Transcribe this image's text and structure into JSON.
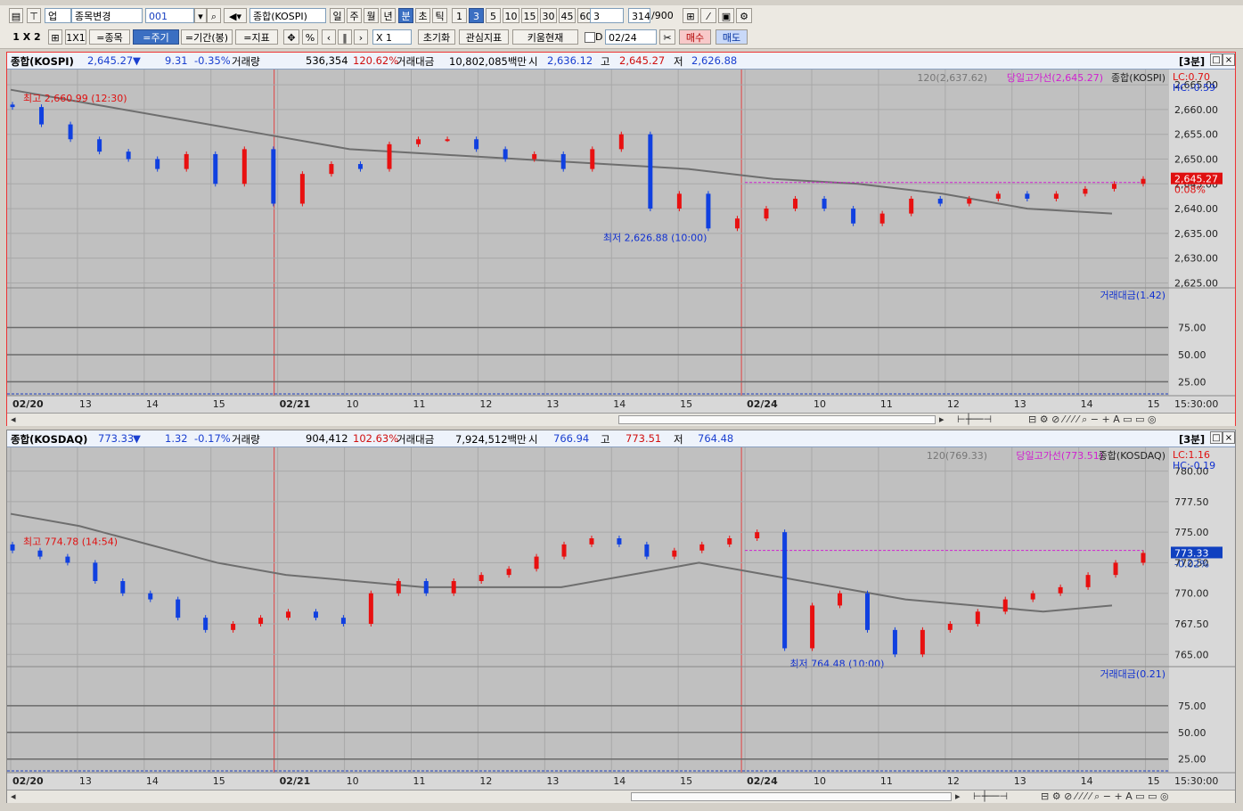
{
  "toolbar1": {
    "market": "업",
    "change_item": "종목변경",
    "code": "001",
    "name": "종합(KOSPI)",
    "periods": [
      "일",
      "주",
      "월",
      "년",
      "분",
      "초",
      "틱"
    ],
    "active_period": "분",
    "minutes": [
      "1",
      "3",
      "5",
      "10",
      "15",
      "30",
      "45",
      "60"
    ],
    "active_minute": "3",
    "count_select": "3",
    "count": "314",
    "count_max": "/900"
  },
  "toolbar2": {
    "layout": "1 X 2",
    "layout2": "1X1",
    "btn_item": "=종목",
    "btn_cycle": "=주기",
    "btn_period": "=기간(봉)",
    "btn_indicator": "=지표",
    "zoom": "X 1",
    "reset": "초기화",
    "watch": "관심지표",
    "kiwoom": "키움현재",
    "date_label": "D",
    "date": "02/24",
    "buy": "매수",
    "sell": "매도"
  },
  "panel_icons": {
    "restore": "□",
    "close": "×"
  },
  "charts": [
    {
      "header": {
        "name": "종합(KOSPI)",
        "price": "2,645.27",
        "arrow": "▼",
        "change": "9.31",
        "rate": "-0.35%",
        "vol_label": "거래량",
        "volume": "536,354",
        "vol_rate": "120.62%",
        "amt_label": "거래대금",
        "amount": "10,802,085백만",
        "open_label": "시",
        "open": "2,636.12",
        "high_label": "고",
        "high": "2,645.27",
        "low_label": "저",
        "low": "2,626.88",
        "interval": "[3분]"
      },
      "legend": {
        "ma": "120(2,637.62)",
        "limit": "당일고가선(2,645.27)",
        "main": "종합(KOSPI)"
      },
      "lc": "LC:0.70",
      "hc": "HC:-0.59",
      "current_label": "2,645.27",
      "current_pct": "0.08%",
      "max_note": "최고 2,660.99 (12:30)",
      "min_note": "최저 2,626.88 (10:00)",
      "sub_legend": "거래대금(1.42)",
      "sub_ticks": [
        "75.00",
        "50.00",
        "25.00"
      ],
      "time_corner": "15:30:00",
      "x_labels": [
        "02/20",
        "13",
        "14",
        "15",
        "02/21",
        "10",
        "11",
        "12",
        "13",
        "14",
        "15",
        "02/24",
        "10",
        "11",
        "12",
        "13",
        "14",
        "15"
      ],
      "colors": {
        "up": "#e81010",
        "down": "#1040e0",
        "ma": "#6e6e6e",
        "limit": "#d020d0"
      },
      "chart_data": {
        "type": "candlestick",
        "y_ticks": [
          "2,665.00",
          "2,660.00",
          "2,655.00",
          "2,650.00",
          "2,645.00",
          "2,640.00",
          "2,635.00",
          "2,630.00",
          "2,625.00"
        ],
        "ylim": [
          2624,
          2667
        ],
        "series": [
          {
            "name": "종합(KOSPI)",
            "values": [
              2660.5,
              2657,
              2654,
              2651.5,
              2650,
              2648,
              2651,
              2645,
              2652,
              2641,
              2647,
              2649,
              2648,
              2653,
              2654,
              2654,
              2652,
              2650,
              2651,
              2648,
              2652,
              2655,
              2640,
              2643,
              2636,
              2638,
              2640,
              2642,
              2640,
              2637,
              2639,
              2642,
              2641,
              2642,
              2643,
              2642,
              2643,
              2644,
              2645,
              2646
            ]
          }
        ],
        "ma120": [
          2664,
          2661,
          2658,
          2655,
          2652,
          2651,
          2650,
          2649,
          2648,
          2646,
          2645,
          2643,
          2640,
          2639
        ],
        "day_high_line": 2645.27
      }
    },
    {
      "header": {
        "name": "종합(KOSDAQ)",
        "price": "773.33",
        "arrow": "▼",
        "change": "1.32",
        "rate": "-0.17%",
        "vol_label": "거래량",
        "volume": "904,412",
        "vol_rate": "102.63%",
        "amt_label": "거래대금",
        "amount": "7,924,512백만",
        "open_label": "시",
        "open": "766.94",
        "high_label": "고",
        "high": "773.51",
        "low_label": "저",
        "low": "764.48",
        "interval": "[3분]"
      },
      "legend": {
        "ma": "120(769.33)",
        "limit": "당일고가선(773.51)",
        "main": "종합(KOSDAQ)"
      },
      "lc": "LC:1.16",
      "hc": "HC:-0.19",
      "current_label": "773.33",
      "current_pct": "-0.02%",
      "max_note": "최고 774.78 (14:54)",
      "min_note": "최저 764.48 (10:00)",
      "sub_legend": "거래대금(0.21)",
      "sub_ticks": [
        "75.00",
        "50.00",
        "25.00"
      ],
      "time_corner": "15:30:00",
      "x_labels": [
        "02/20",
        "13",
        "14",
        "15",
        "02/21",
        "10",
        "11",
        "12",
        "13",
        "14",
        "15",
        "02/24",
        "10",
        "11",
        "12",
        "13",
        "14",
        "15"
      ],
      "colors": {
        "up": "#e81010",
        "down": "#1040e0",
        "ma": "#6e6e6e",
        "limit": "#d020d0"
      },
      "chart_data": {
        "type": "candlestick",
        "y_ticks": [
          "780.00",
          "777.50",
          "775.00",
          "772.50",
          "770.00",
          "767.50",
          "765.00"
        ],
        "ylim": [
          764,
          781.5
        ],
        "series": [
          {
            "name": "종합(KOSDAQ)",
            "values": [
              773.5,
              773,
              772.5,
              771,
              770,
              769.5,
              768,
              767,
              767.5,
              768,
              768.5,
              768,
              767.5,
              770,
              771,
              770,
              771,
              771.5,
              772,
              773,
              774,
              774.5,
              774,
              773,
              773.5,
              774,
              774.5,
              775,
              765.5,
              769,
              770,
              767,
              765,
              767,
              767.5,
              768.5,
              769.5,
              770,
              770.5,
              771.5,
              772.5,
              773.3
            ]
          }
        ],
        "ma120": [
          776.5,
          775.5,
          774,
          772.5,
          771.5,
          771,
          770.5,
          770.5,
          770.5,
          771.5,
          772.5,
          771.5,
          770.5,
          769.5,
          769,
          768.5,
          769
        ],
        "day_high_line": 773.51
      }
    }
  ]
}
